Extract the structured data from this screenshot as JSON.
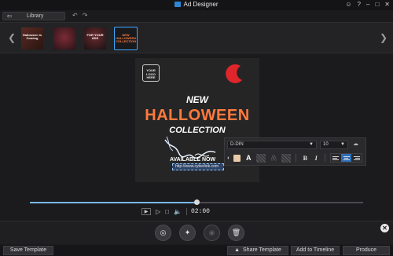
{
  "app": {
    "title": "Ad Designer"
  },
  "window_controls": [
    "account-icon",
    "help-icon",
    "minimize-icon",
    "maximize-icon",
    "close-icon"
  ],
  "toolbar": {
    "library_label": "Library"
  },
  "templates": [
    {
      "text": "Halloween is Coming"
    },
    {
      "text": ""
    },
    {
      "text": "FOR YOUR ADS"
    },
    {
      "text": "NEW HALLOWEEN COLLECTION",
      "selected": true
    }
  ],
  "canvas": {
    "logo_text": "YOUR LOGO HERE",
    "new": "NEW",
    "halloween": "HALLOWEEN",
    "collection": "COLLECTION",
    "available": "AVAILABLE NOW",
    "url": "http://www.cyberlink.com",
    "accent_color": "#ff7a3d"
  },
  "format_bar": {
    "font": "D-DIN",
    "size": "10",
    "bold": "B",
    "italic": "I",
    "fill_color": "#e8c9a8",
    "effects": [
      "A",
      "A",
      "A"
    ],
    "alignment": "center"
  },
  "timeline": {
    "progress": 0.5,
    "time": "02:00"
  },
  "footer": {
    "save_template": "Save Template",
    "share_template": "Share Template",
    "add_to_timeline": "Add to Timeline",
    "produce": "Produce"
  }
}
